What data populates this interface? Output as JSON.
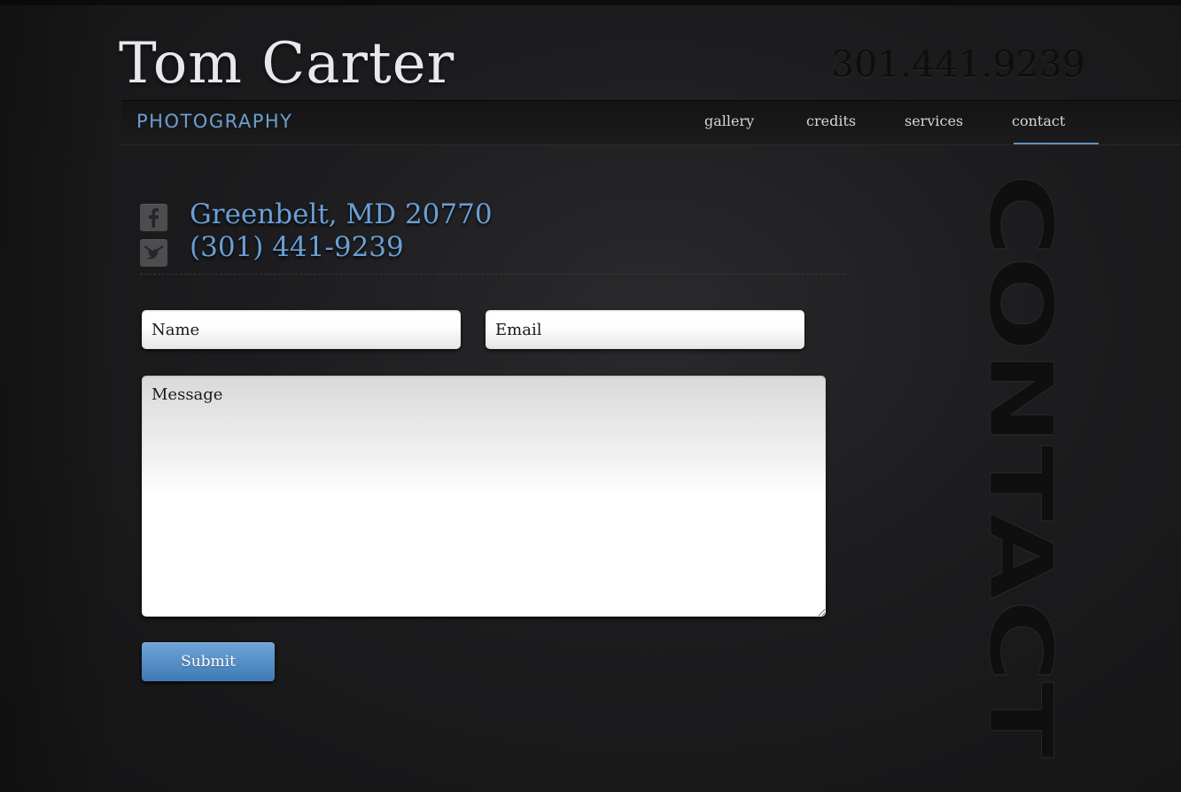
{
  "header": {
    "title": "Tom Carter",
    "phone": "301.441.9239",
    "subtitle": "PHOTOGRAPHY"
  },
  "nav": {
    "items": [
      {
        "label": "gallery",
        "active": false
      },
      {
        "label": "credits",
        "active": false
      },
      {
        "label": "services",
        "active": false
      },
      {
        "label": "contact",
        "active": true
      }
    ]
  },
  "watermark": "CONTACT",
  "contact": {
    "address": "Greenbelt, MD 20770",
    "phone": "(301) 441-9239",
    "icons": [
      "facebook-icon",
      "twitter-icon"
    ]
  },
  "form": {
    "name_placeholder": "Name",
    "email_placeholder": "Email",
    "message_placeholder": "Message",
    "submit_label": "Submit"
  },
  "colors": {
    "accent": "#6a9fd6",
    "nav_underline": "#5e8fbf",
    "button": "#4f8bc6",
    "background": "#1c1c1e"
  }
}
